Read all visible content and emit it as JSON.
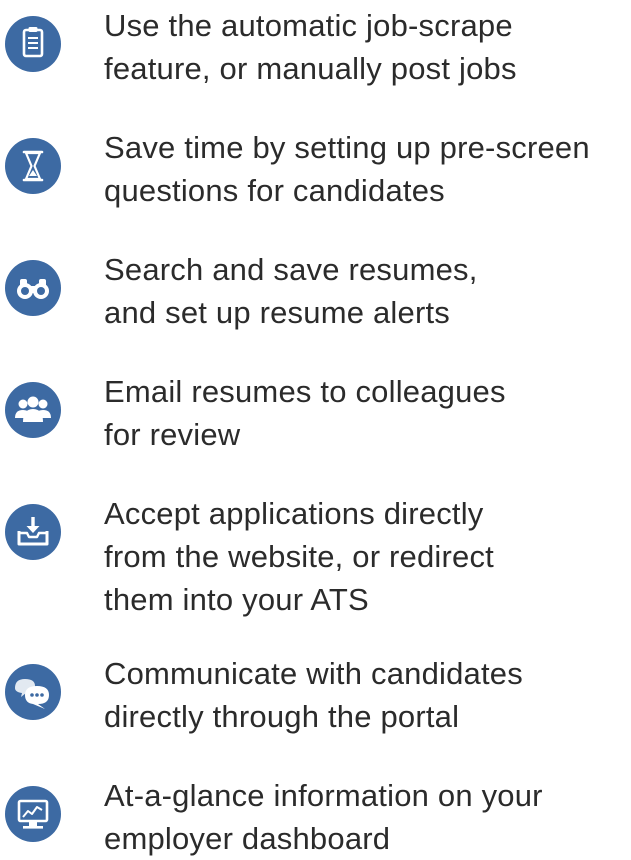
{
  "theme": {
    "accent": "#3d6aa3",
    "text": "#2b2b2b",
    "background": "#ffffff"
  },
  "features": [
    {
      "icon": "clipboard-icon",
      "text": "Use the automatic job-scrape\nfeature, or manually post jobs"
    },
    {
      "icon": "hourglass-icon",
      "text": "Save time by setting up pre-screen\nquestions for candidates"
    },
    {
      "icon": "binoculars-icon",
      "text": "Search and save resumes,\nand set up resume alerts"
    },
    {
      "icon": "group-icon",
      "text": "Email resumes to colleagues\nfor review"
    },
    {
      "icon": "inbox-download-icon",
      "text": "Accept applications directly\nfrom the website, or redirect\nthem into your ATS"
    },
    {
      "icon": "chat-bubbles-icon",
      "text": "Communicate with candidates\ndirectly through the portal"
    },
    {
      "icon": "dashboard-chart-icon",
      "text": "At-a-glance information on your\nemployer dashboard"
    }
  ]
}
